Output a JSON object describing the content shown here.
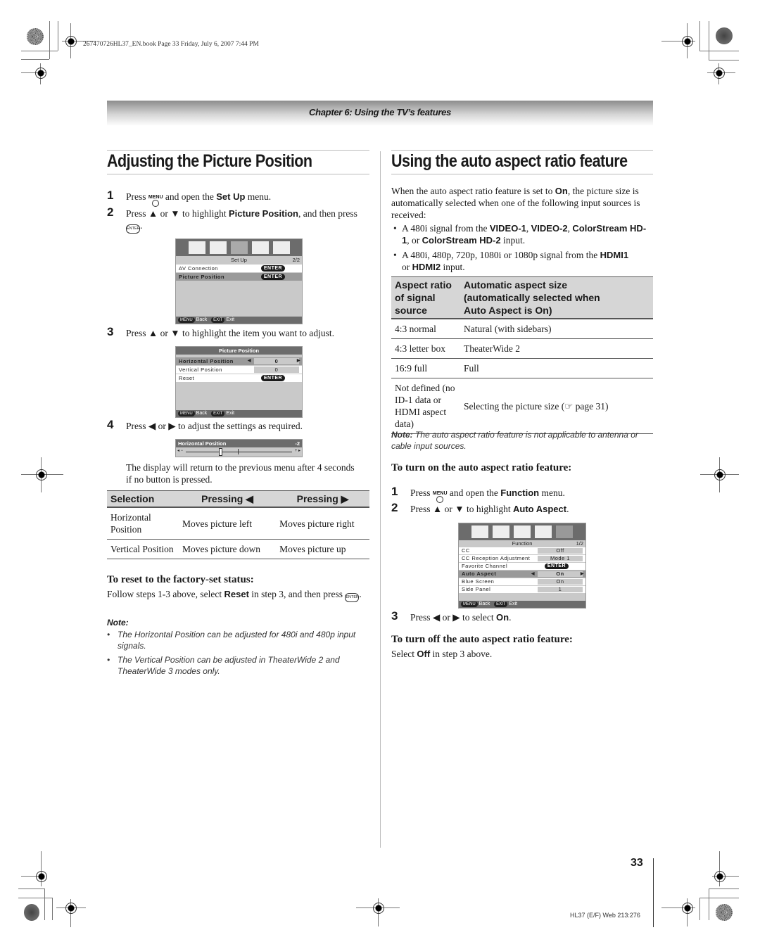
{
  "print_header": "267470726HL37_EN.book  Page 33  Friday, July 6, 2007  7:44 PM",
  "chapter": "Chapter 6: Using the TV’s features",
  "left": {
    "title": "Adjusting the Picture Position",
    "steps": [
      {
        "num": "1",
        "pre": "Press ",
        "button": "MENU",
        "mid": " and open the ",
        "bold": "Set Up",
        "post": " menu."
      },
      {
        "num": "2",
        "pre": "Press ▲ or ▼ to highlight ",
        "bold": "Picture Position",
        "post": ", and then press ",
        "button": "ENTER"
      },
      {
        "num": "3",
        "text": "Press ▲ or ▼ to highlight the item you want to adjust."
      },
      {
        "num": "4",
        "text": "Press ◀ or ▶ to adjust the settings as required."
      }
    ],
    "osd_setup": {
      "menu_title": "Set Up",
      "page": "2/2",
      "items": [
        {
          "label": "AV Connection",
          "value": "ENTER"
        },
        {
          "label": "Picture Position",
          "value": "ENTER",
          "highlighted": true
        }
      ],
      "footer_back_key": "MENU",
      "footer_back": "Back",
      "footer_exit_key": "EXIT",
      "footer_exit": "Exit"
    },
    "osd_picture_position": {
      "title": "Picture Position",
      "items": [
        {
          "label": "Horizontal Position",
          "value": "0",
          "highlighted": true
        },
        {
          "label": "Vertical Position",
          "value": "0"
        },
        {
          "label": "Reset",
          "value": "ENTER"
        }
      ],
      "footer_back_key": "MENU",
      "footer_back": "Back",
      "footer_exit_key": "EXIT",
      "footer_exit": "Exit"
    },
    "osd_slider": {
      "label": "Horizontal Position",
      "value": "-2",
      "min_glyph": "◂ −",
      "max_glyph": "+ ▸"
    },
    "return_note": "The display will return to the previous menu after 4 seconds if no button is pressed.",
    "table": {
      "headers": [
        "Selection",
        "Pressing ◀",
        "Pressing ▶"
      ],
      "rows": [
        [
          "Horizontal Position",
          "Moves picture left",
          "Moves picture right"
        ],
        [
          "Vertical Position",
          "Moves picture down",
          "Moves picture up"
        ]
      ]
    },
    "reset_heading": "To reset to the factory-set status:",
    "reset_text_pre": "Follow steps 1-3 above, select ",
    "reset_text_bold": "Reset",
    "reset_text_post": " in step 3, and then press ",
    "note_label": "Note:",
    "notes": [
      "The Horizontal Position can be adjusted for 480i and 480p input signals.",
      "The Vertical Position can be adjusted in TheaterWide 2 and TheaterWide 3 modes only."
    ]
  },
  "right": {
    "title": "Using the auto aspect ratio feature",
    "intro_pre": "When the auto aspect ratio feature is set to ",
    "intro_bold": "On",
    "intro_post": ", the picture size is automatically selected when one of the following input sources is received:",
    "bullet1_pre": "A 480i signal from the ",
    "bullet1_b1": "VIDEO-1",
    "bullet1_b2": "VIDEO-2",
    "bullet1_b3": "ColorStream HD-1",
    "bullet1_b4": "ColorStream HD-2",
    "bullet1_post": " input.",
    "bullet2_pre": "A 480i, 480p, 720p, 1080i or 1080p signal from the ",
    "bullet2_b1": "HDMI1",
    "bullet2_b2": "HDMI2",
    "bullet2_post": " input.",
    "table": {
      "headers": [
        "Aspect ratio of signal source",
        "Automatic aspect size (automatically selected when Auto Aspect is On)"
      ],
      "rows": [
        [
          "4:3 normal",
          "Natural (with sidebars)"
        ],
        [
          "4:3 letter box",
          "TheaterWide 2"
        ],
        [
          "16:9 full",
          "Full"
        ],
        [
          "Not defined (no ID-1 data or HDMI aspect data)",
          "Selecting the picture size (☞ page 31)"
        ]
      ]
    },
    "note_label": "Note:",
    "note_text": "The auto aspect ratio feature is not applicable to antenna or cable input sources.",
    "on_heading": "To turn on the auto aspect ratio feature:",
    "steps": [
      {
        "num": "1",
        "pre": "Press ",
        "button": "MENU",
        "mid": " and open the ",
        "bold": "Function",
        "post": " menu."
      },
      {
        "num": "2",
        "pre": "Press ▲ or ▼ to highlight ",
        "bold": "Auto Aspect",
        "post": "."
      },
      {
        "num": "3",
        "pre": "Press ◀ or ▶ to select ",
        "bold": "On",
        "post": "."
      }
    ],
    "osd_function": {
      "menu_title": "Function",
      "page": "1/2",
      "items": [
        {
          "label": "CC",
          "value": "Off"
        },
        {
          "label": "CC Reception Adjustment",
          "value": "Mode 1"
        },
        {
          "label": "Favorite Channel",
          "value": "ENTER"
        },
        {
          "label": "Auto Aspect",
          "value": "On",
          "highlighted": true
        },
        {
          "label": "Blue Screen",
          "value": "On"
        },
        {
          "label": "Side Panel",
          "value": "1"
        }
      ],
      "footer_back_key": "MENU",
      "footer_back": "Back",
      "footer_exit_key": "EXIT",
      "footer_exit": "Exit"
    },
    "off_heading": "To turn off the auto aspect ratio feature:",
    "off_pre": "Select ",
    "off_bold": "Off",
    "off_post": " in step 3 above."
  },
  "page_number": "33",
  "footer_code": "HL37 (E/F) Web 213:276"
}
